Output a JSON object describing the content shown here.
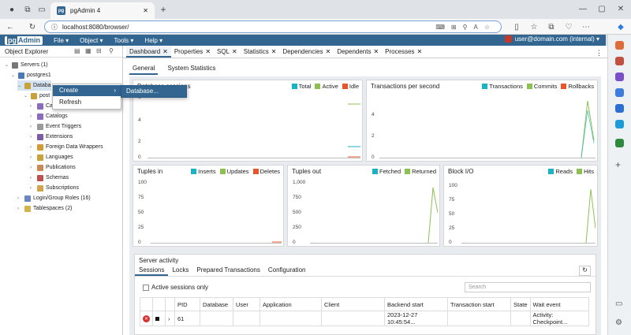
{
  "browser": {
    "tab_title": "pgAdmin 4",
    "url": "localhost:8080/browser/"
  },
  "navbar": {
    "logo_pg": "pg",
    "logo_admin": "Admin",
    "menus": [
      "File ▾",
      "Object ▾",
      "Tools ▾",
      "Help ▾"
    ],
    "user": "user@domain.com (internal) ▾"
  },
  "explorer": {
    "title": "Object Explorer",
    "tree": [
      {
        "label": "Servers (1)",
        "indent": 0,
        "chev": "⌄",
        "color": "#777777"
      },
      {
        "label": "postgres1",
        "indent": 1,
        "chev": "⌄",
        "color": "#4a7ab5"
      },
      {
        "label": "Databa",
        "indent": 2,
        "chev": "⌄",
        "color": "#c8a13a"
      },
      {
        "label": "post",
        "indent": 3,
        "chev": "⌄",
        "color": "#c8a13a"
      },
      {
        "label": "Ca",
        "indent": 4,
        "chev": "›",
        "color": "#8a6bbd"
      },
      {
        "label": "Catalogs",
        "indent": 4,
        "chev": "›",
        "color": "#8a6bbd"
      },
      {
        "label": "Event Triggers",
        "indent": 4,
        "chev": "›",
        "color": "#999999"
      },
      {
        "label": "Extensions",
        "indent": 4,
        "chev": "›",
        "color": "#7a5ba8"
      },
      {
        "label": "Foreign Data Wrappers",
        "indent": 4,
        "chev": "›",
        "color": "#d59a34"
      },
      {
        "label": "Languages",
        "indent": 4,
        "chev": "›",
        "color": "#c8a13a"
      },
      {
        "label": "Publications",
        "indent": 4,
        "chev": "›",
        "color": "#cc8855"
      },
      {
        "label": "Schemas",
        "indent": 4,
        "chev": "›",
        "color": "#c0504d"
      },
      {
        "label": "Subscriptions",
        "indent": 4,
        "chev": "›",
        "color": "#d5a34c"
      },
      {
        "label": "Login/Group Roles (16)",
        "indent": 2,
        "chev": "›",
        "color": "#6a87c2"
      },
      {
        "label": "Tablespaces (2)",
        "indent": 2,
        "chev": "›",
        "color": "#d4b24c"
      }
    ]
  },
  "context_menu": {
    "create": "Create",
    "refresh": "Refresh",
    "submenu_database": "Database..."
  },
  "main_tabs": [
    "Dashboard",
    "Properties",
    "SQL",
    "Statistics",
    "Dependencies",
    "Dependents",
    "Processes"
  ],
  "sub_tabs": [
    "General",
    "System Statistics"
  ],
  "colors": {
    "teal": "#1ab3c6",
    "green": "#8cc152",
    "orange": "#e8542b"
  },
  "panels": {
    "sessions": {
      "title": "Database sessions",
      "legend": [
        "Total",
        "Active",
        "Idle"
      ],
      "yticks": [
        "6",
        "4",
        "2",
        "0"
      ]
    },
    "tps": {
      "title": "Transactions per second",
      "legend": [
        "Transactions",
        "Commits",
        "Rollbacks"
      ],
      "yticks": [
        "4",
        "2",
        "0"
      ]
    },
    "tuples_in": {
      "title": "Tuples in",
      "legend": [
        "Inserts",
        "Updates",
        "Deletes"
      ],
      "yticks": [
        "100",
        "75",
        "50",
        "25",
        "0"
      ]
    },
    "tuples_out": {
      "title": "Tuples out",
      "legend": [
        "Fetched",
        "Returned"
      ],
      "yticks": [
        "1,000",
        "750",
        "500",
        "250",
        "0"
      ]
    },
    "block_io": {
      "title": "Block I/O",
      "legend": [
        "Reads",
        "Hits"
      ],
      "yticks": [
        "100",
        "75",
        "50",
        "25",
        "0"
      ]
    }
  },
  "activity": {
    "title": "Server activity",
    "tabs": [
      "Sessions",
      "Locks",
      "Prepared Transactions",
      "Configuration"
    ],
    "active_only": "Active sessions only",
    "search_placeholder": "Search",
    "columns": [
      "PID",
      "Database",
      "User",
      "Application",
      "Client",
      "Backend start",
      "Transaction start",
      "State",
      "Wait event"
    ],
    "rows": [
      {
        "pid": "61",
        "database": "",
        "user": "",
        "application": "",
        "client": "",
        "backend_start": "2023-12-27 10:45:54...",
        "transaction_start": "",
        "state": "",
        "wait_event": "Activity: Checkpoint..."
      }
    ]
  }
}
